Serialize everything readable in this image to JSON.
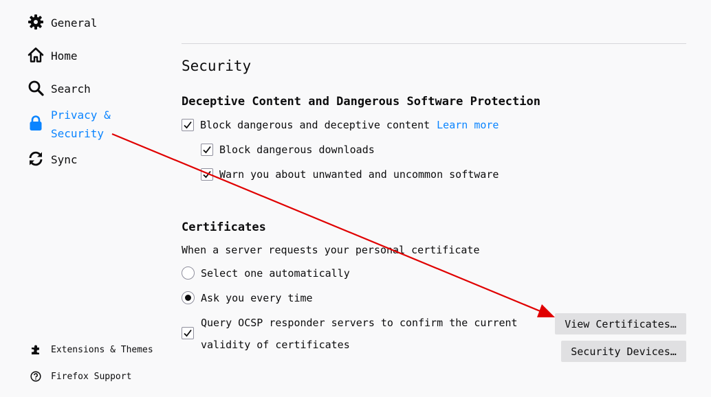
{
  "sidebar": {
    "items": [
      {
        "label": "General",
        "icon": "gear-icon"
      },
      {
        "label": "Home",
        "icon": "home-icon"
      },
      {
        "label": "Search",
        "icon": "search-icon"
      },
      {
        "label": "Privacy & Security",
        "icon": "lock-icon",
        "selected": true
      },
      {
        "label": "Sync",
        "icon": "sync-icon"
      }
    ],
    "footer": [
      {
        "label": "Extensions & Themes",
        "icon": "puzzle-icon"
      },
      {
        "label": "Firefox Support",
        "icon": "help-icon"
      }
    ]
  },
  "main": {
    "title": "Security",
    "deceptive": {
      "heading": "Deceptive Content and Dangerous Software Protection",
      "block_label": "Block dangerous and deceptive content",
      "learn_more": "Learn more",
      "downloads_label": "Block dangerous downloads",
      "unwanted_label": "Warn you about unwanted and uncommon software",
      "block_checked": true,
      "downloads_checked": true,
      "unwanted_checked": true
    },
    "certificates": {
      "heading": "Certificates",
      "prompt": "When a server requests your personal certificate",
      "option_auto": "Select one automatically",
      "option_ask": "Ask you every time",
      "selected_option": "Ask you every time",
      "ocsp_line1": "Query OCSP responder servers to confirm the current",
      "ocsp_line2": "validity of certificates",
      "ocsp_checked": true,
      "view_certificates_button": "View Certificates…",
      "security_devices_button": "Security Devices…"
    }
  },
  "colors": {
    "accent": "#0a84ff",
    "annotation_arrow": "#e00000",
    "background": "#f9f9fa",
    "button": "#e0e0e2"
  }
}
